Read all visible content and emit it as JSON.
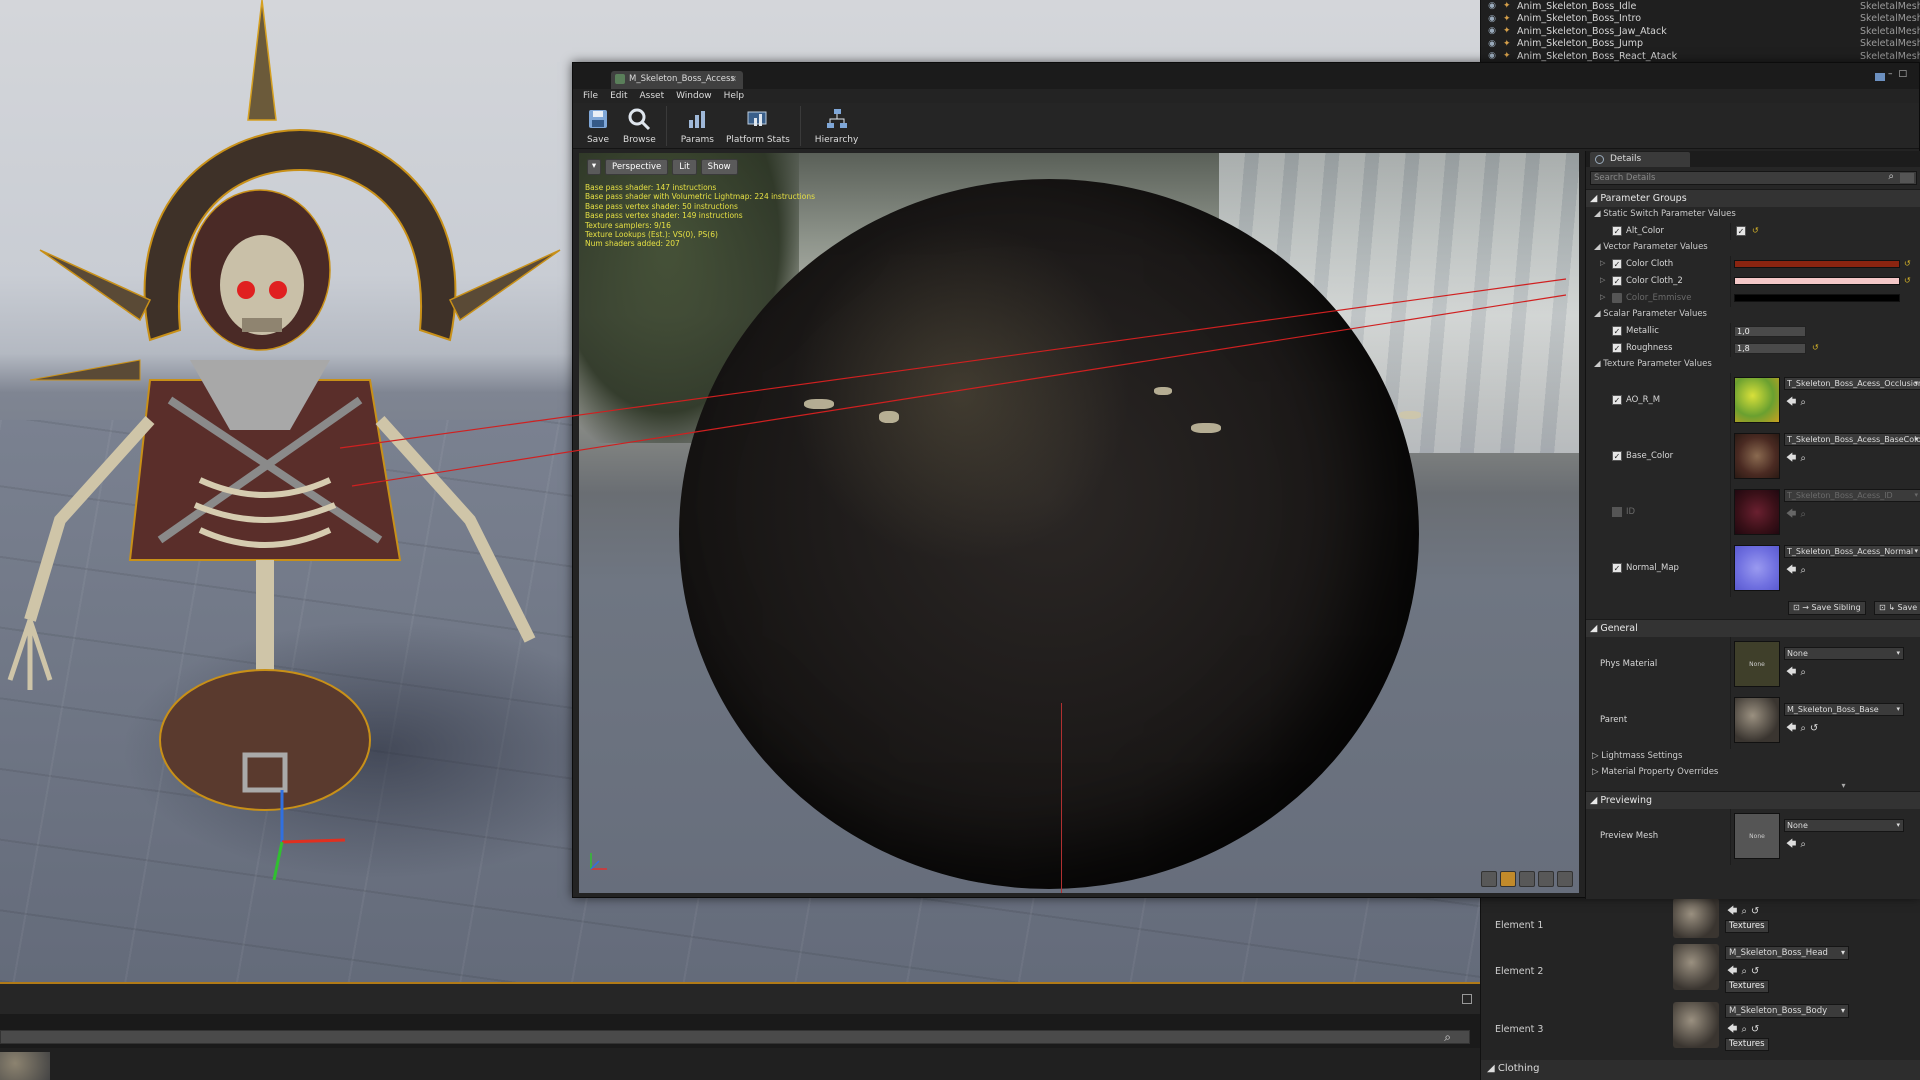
{
  "asset_list": [
    {
      "name": "Anim_Skeleton_Boss_Idle",
      "type": "SkeletalMeshA"
    },
    {
      "name": "Anim_Skeleton_Boss_Intro",
      "type": "SkeletalMeshA"
    },
    {
      "name": "Anim_Skeleton_Boss_Jaw_Atack",
      "type": "SkeletalMeshA"
    },
    {
      "name": "Anim_Skeleton_Boss_Jump",
      "type": "SkeletalMeshA"
    },
    {
      "name": "Anim_Skeleton_Boss_React_Atack",
      "type": "SkeletalMeshA"
    }
  ],
  "material_window": {
    "tab_title": "M_Skeleton_Boss_Access",
    "menu": [
      "File",
      "Edit",
      "Asset",
      "Window",
      "Help"
    ],
    "toolbar": [
      {
        "label": "Save",
        "icon": "save-icon"
      },
      {
        "label": "Browse",
        "icon": "browse-icon"
      },
      {
        "label": "Params",
        "icon": "params-icon"
      },
      {
        "label": "Platform Stats",
        "icon": "platform-stats-icon"
      },
      {
        "label": "Hierarchy",
        "icon": "hierarchy-icon"
      }
    ]
  },
  "viewport": {
    "buttons": {
      "perspective": "Perspective",
      "lit": "Lit",
      "show": "Show"
    },
    "stats": [
      "Base pass shader: 147 instructions",
      "Base pass shader with Volumetric Lightmap: 224 instructions",
      "Base pass vertex shader: 50 instructions",
      "Base pass vertex shader: 149 instructions",
      "Texture samplers: 9/16",
      "Texture Lookups (Est.): VS(0), PS(6)",
      "Num shaders added: 207"
    ]
  },
  "details": {
    "tab": "Details",
    "search_placeholder": "Search Details",
    "parameter_groups": "Parameter Groups",
    "static_switch": "Static Switch Parameter Values",
    "alt_color": "Alt_Color",
    "vector_params": "Vector Parameter Values",
    "vectors": [
      {
        "label": "Color Cloth",
        "color": "#8a2410",
        "enabled": true
      },
      {
        "label": "Color Cloth_2",
        "color": "#f4c8c8",
        "enabled": true
      },
      {
        "label": "Color_Emmisve",
        "color": "#000000",
        "enabled": false
      }
    ],
    "scalar_params": "Scalar Parameter Values",
    "scalars": [
      {
        "label": "Metallic",
        "value": "1,0"
      },
      {
        "label": "Roughness",
        "value": "1,8"
      }
    ],
    "texture_params": "Texture Parameter Values",
    "textures": [
      {
        "label": "AO_R_M",
        "asset": "T_Skeleton_Boss_Acess_OcclusionRoughnessMe",
        "enabled": true
      },
      {
        "label": "Base_Color",
        "asset": "T_Skeleton_Boss_Acess_BaseColor",
        "enabled": true
      },
      {
        "label": "ID",
        "asset": "T_Skeleton_Boss_Acess_ID",
        "enabled": false
      },
      {
        "label": "Normal_Map",
        "asset": "T_Skeleton_Boss_Acess_Normal",
        "enabled": true
      }
    ],
    "save_sibling": "Save Sibling",
    "save_child": "Save Cl",
    "general": "General",
    "phys_material_label": "Phys Material",
    "phys_material_value": "None",
    "parent_label": "Parent",
    "parent_value": "M_Skeleton_Boss_Base",
    "lightmass": "Lightmass Settings",
    "material_overrides": "Material Property Overrides",
    "previewing": "Previewing",
    "preview_mesh_label": "Preview Mesh",
    "preview_mesh_value": "None",
    "none_thumb": "None"
  },
  "elements": [
    {
      "label": "Element 1",
      "material": "",
      "textures": "Textures"
    },
    {
      "label": "Element 2",
      "material": "M_Skeleton_Boss_Head",
      "textures": "Textures"
    },
    {
      "label": "Element 3",
      "material": "M_Skeleton_Boss_Body",
      "textures": "Textures"
    }
  ],
  "clothing": "Clothing"
}
